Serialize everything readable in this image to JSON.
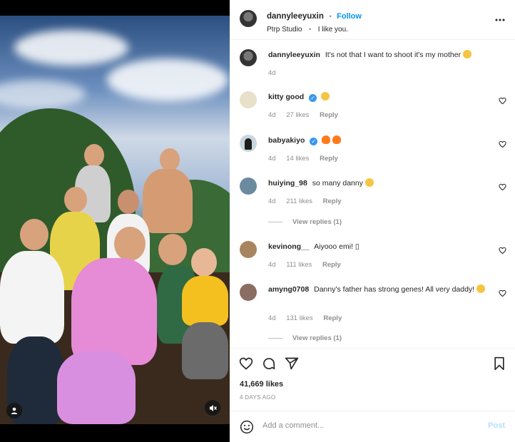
{
  "header": {
    "username": "dannyleeyuxin",
    "follow_label": "Follow",
    "separator": "•",
    "audio": "Ptrp Studio",
    "song": "I like you."
  },
  "caption": {
    "username": "dannyleeyuxin",
    "text": "It's not that I want to shoot it's my mother",
    "time": "4d"
  },
  "comments": [
    {
      "username": "kitty good",
      "text": "",
      "time": "4d",
      "likes": "27 likes",
      "reply": "Reply",
      "verified": true
    },
    {
      "username": "babyakiyo",
      "text": "",
      "time": "4d",
      "likes": "14 likes",
      "reply": "Reply",
      "verified": true
    },
    {
      "username": "huiying_98",
      "text": "so many danny",
      "time": "4d",
      "likes": "211 likes",
      "reply": "Reply",
      "view_replies": "View replies (1)"
    },
    {
      "username": "kevinong__",
      "text": "Aiyooo emi! ▯",
      "time": "4d",
      "likes": "111 likes",
      "reply": "Reply"
    },
    {
      "username": "amyng0708",
      "text": "Danny's father has strong genes! All very daddy!",
      "time": "4d",
      "likes": "131 likes",
      "reply": "Reply",
      "view_replies": "View replies (1)"
    }
  ],
  "post": {
    "likes": "41,669 likes",
    "date": "4 DAYS AGO"
  },
  "composer": {
    "placeholder": "Add a comment...",
    "post_label": "Post"
  },
  "icons": [
    "more-icon",
    "heart-icon",
    "comment-icon",
    "share-icon",
    "bookmark-icon",
    "emoji-icon",
    "mute-icon",
    "user-tag-icon"
  ],
  "colors": {
    "accent": "#0095f6",
    "verified": "#3897f0",
    "muted": "#8e8e8e"
  }
}
